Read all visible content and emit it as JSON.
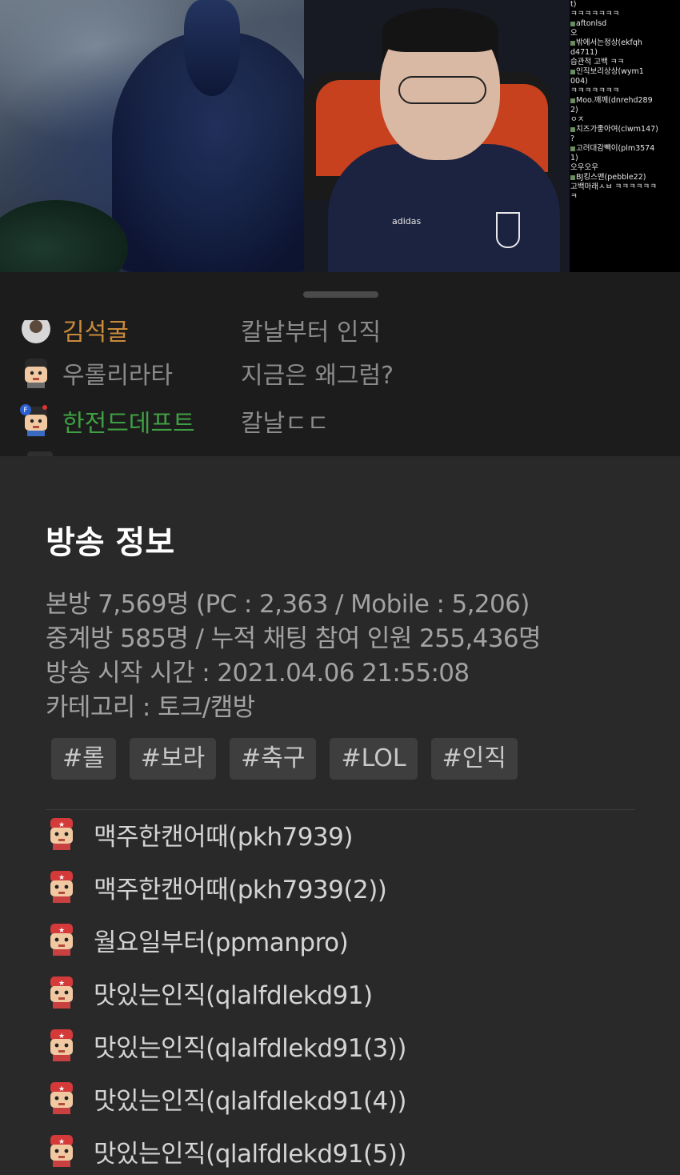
{
  "side_chat": [
    {
      "text": "t)"
    },
    {
      "text": "ㅋㅋㅋㅋㅋㅋㅋ"
    },
    {
      "text": "aftonlsd",
      "nick": true
    },
    {
      "text": "오"
    },
    {
      "text": "밖에서는정상(ekfqh",
      "nick": true
    },
    {
      "text": "d4711)"
    },
    {
      "text": "습관적 고백 ㅋㅋ"
    },
    {
      "text": "인직보리상상(wym1",
      "nick": true
    },
    {
      "text": "004)"
    },
    {
      "text": "ㅋㅋㅋㅋㅋㅋㅋ"
    },
    {
      "text": "Moo.깨깨(dnrehd289",
      "nick": true
    },
    {
      "text": "2)"
    },
    {
      "text": "ㅇㅈ"
    },
    {
      "text": "치즈가좋아여(clwm147)",
      "nick": true
    },
    {
      "text": "?"
    },
    {
      "text": "고려대감빽이(plm3574",
      "nick": true
    },
    {
      "text": "1)"
    },
    {
      "text": "오우오우"
    },
    {
      "text": "BJ킹스맨(pebble22)",
      "nick": true
    },
    {
      "text": "고백마래ㅅㅂ ㅋㅋㅋㅋㅋㅋ"
    },
    {
      "text": "ㅋ"
    }
  ],
  "chat": [
    {
      "nick": "김석굴",
      "message": "칼날부터 인직",
      "nick_color": "#c98a3a"
    },
    {
      "nick": "우롤리라타",
      "message": "지금은 왜그럼?",
      "nick_color": "#8a8a8a"
    },
    {
      "nick": "한전드데프트",
      "message": "칼날ㄷㄷ",
      "nick_color": "#3fa043"
    }
  ],
  "info": {
    "title": "방송 정보",
    "viewers_line": "본방 7,569명 (PC : 2,363 / Mobile : 5,206)",
    "relay_line": "중계방 585명 / 누적 채팅 참여 인원 255,436명",
    "start_line": "방송 시작 시간 : 2021.04.06 21:55:08",
    "category_line": "카테고리 : 토크/캠방",
    "tags": [
      "#롤",
      "#보라",
      "#축구",
      "#LOL",
      "#인직"
    ],
    "users": [
      "맥주한캔어때(pkh7939)",
      "맥주한캔어때(pkh7939(2))",
      "월요일부터(ppmanpro)",
      "맛있는인직(qlalfdlekd91)",
      "맛있는인직(qlalfdlekd91(3))",
      "맛있는인직(qlalfdlekd91(4))",
      "맛있는인직(qlalfdlekd91(5))"
    ]
  },
  "colors": {
    "background": "#292929",
    "chat_panel": "#1c1c1c",
    "title": "#ffffff",
    "stat_text": "#a2a2a2",
    "tag_bg": "#3e3e3e"
  }
}
